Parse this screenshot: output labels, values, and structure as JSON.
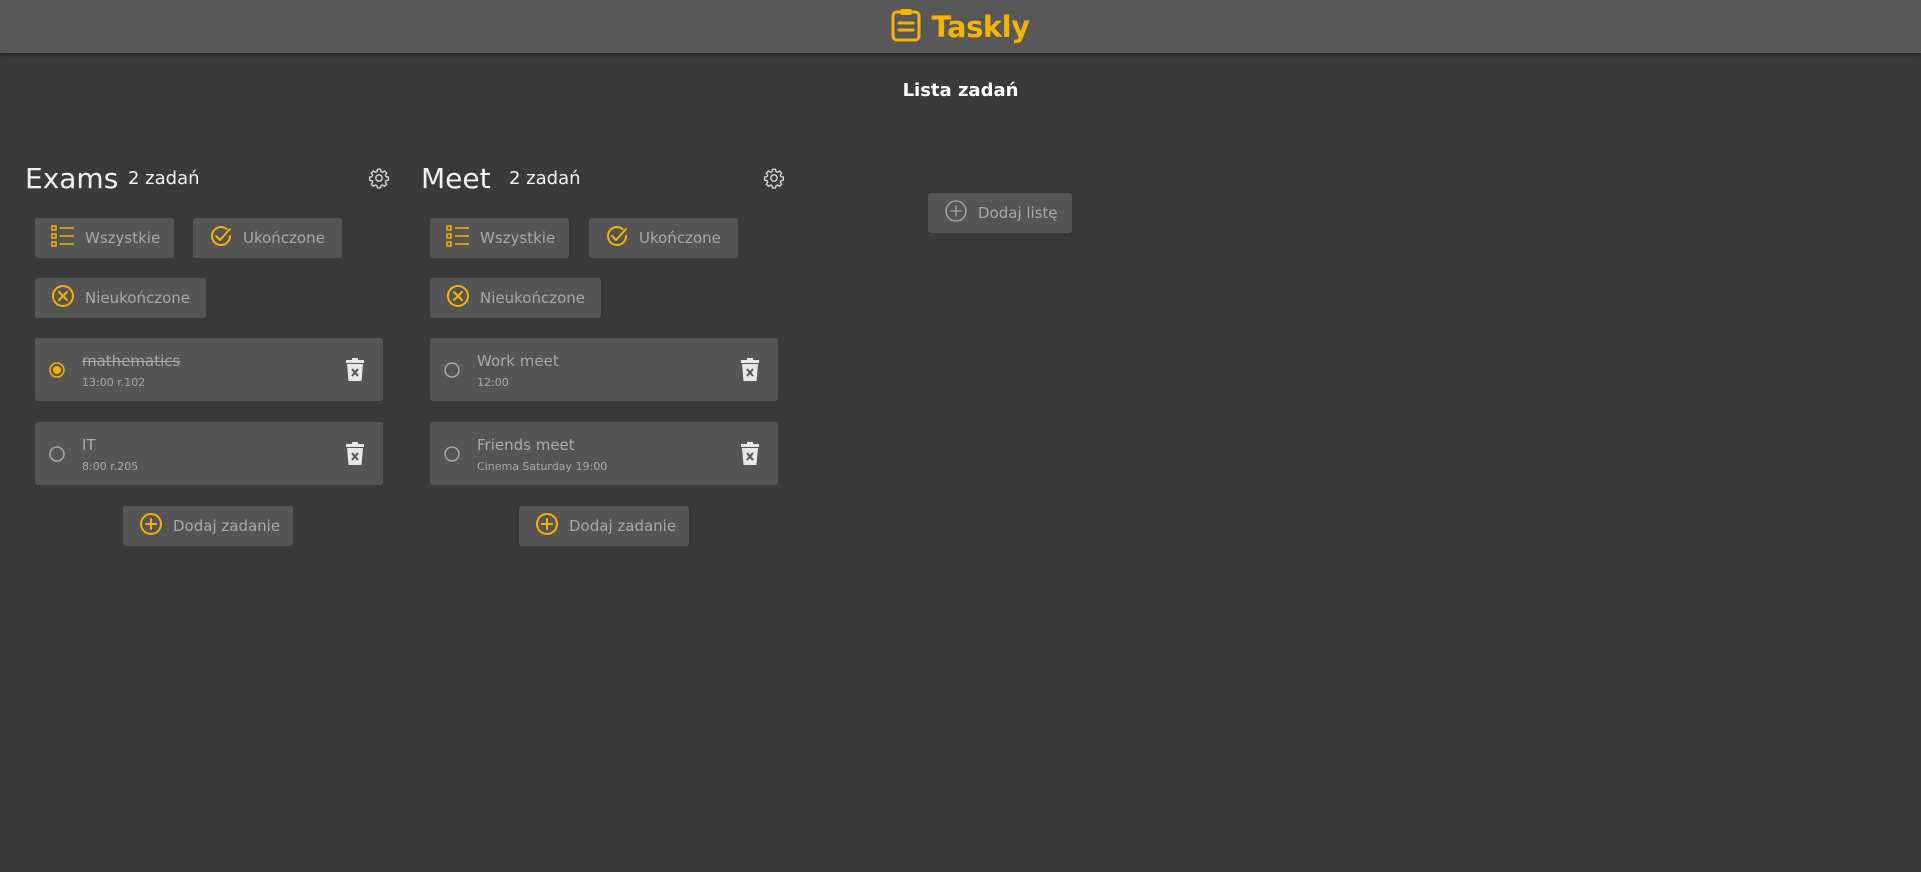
{
  "app": {
    "name": "Taskly",
    "accent_color": "#f5b400",
    "logo_icon": "clipboard-icon"
  },
  "page": {
    "title": "Lista zadań"
  },
  "lists": [
    {
      "name": "Exams",
      "count_label": "2 zadań",
      "filters": {
        "all": "Wszystkie",
        "completed": "Ukończone",
        "incomplete": "Nieukończone"
      },
      "tasks": [
        {
          "title": "mathematics",
          "subtitle": "13:00 r.102",
          "completed": true
        },
        {
          "title": "IT",
          "subtitle": "8:00 r.205",
          "completed": false
        }
      ],
      "add_task_label": "Dodaj zadanie"
    },
    {
      "name": "Meet",
      "count_label": "2 zadań",
      "filters": {
        "all": "Wszystkie",
        "completed": "Ukończone",
        "incomplete": "Nieukończone"
      },
      "tasks": [
        {
          "title": "Work meet",
          "subtitle": "12:00",
          "completed": false
        },
        {
          "title": "Friends meet",
          "subtitle": "Cinema Saturday 19:00",
          "completed": false
        }
      ],
      "add_task_label": "Dodaj zadanie"
    }
  ],
  "add_list_label": "Dodaj listę"
}
